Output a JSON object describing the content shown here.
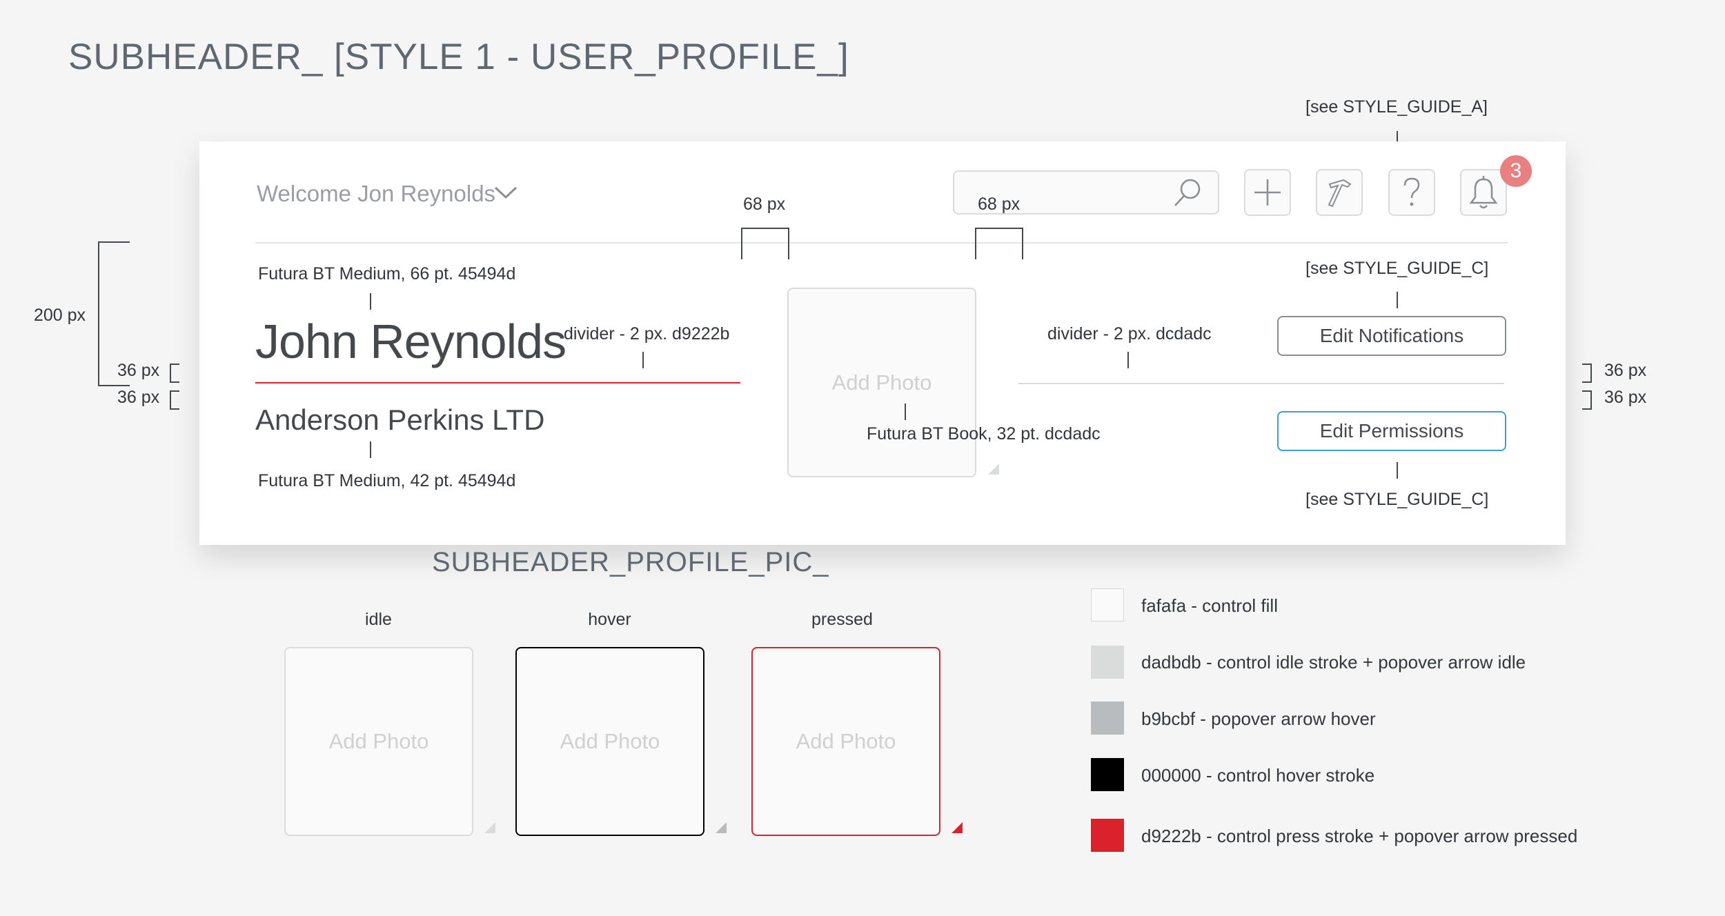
{
  "page": {
    "title": "SUBHEADER_ [STYLE 1 - USER_PROFILE_]"
  },
  "header": {
    "welcome": "Welcome Jon Reynolds",
    "notification_count": "3",
    "style_guide_a": "[see STYLE_GUIDE_A]"
  },
  "profile": {
    "name": "John Reynolds",
    "company": "Anderson Perkins LTD",
    "add_photo": "Add Photo",
    "edit_notifications": "Edit Notifications",
    "edit_permissions": "Edit Permissions"
  },
  "annotations": {
    "spacing_68_left": "68 px",
    "spacing_68_right": "68 px",
    "height_200": "200 px",
    "gap_36_a": "36 px",
    "gap_36_b": "36 px",
    "gap_36_c": "36 px",
    "gap_36_d": "36 px",
    "name_font": "Futura BT Medium, 66 pt. 45494d",
    "company_font": "Futura BT Medium, 42 pt. 45494d",
    "divider_red": "divider - 2 px. d9222b",
    "divider_grey": "divider - 2 px. dcdadc",
    "photo_font": "Futura BT Book, 32 pt. dcdadc",
    "style_guide_c_top": "[see STYLE_GUIDE_C]",
    "style_guide_c_bottom": "[see STYLE_GUIDE_C]"
  },
  "profile_pic": {
    "title": "SUBHEADER_PROFILE_PIC_",
    "states": [
      {
        "label": "idle",
        "text": "Add Photo"
      },
      {
        "label": "hover",
        "text": "Add Photo"
      },
      {
        "label": "pressed",
        "text": "Add Photo"
      }
    ]
  },
  "legend": [
    {
      "color": "#fafafa",
      "label": "fafafa - control fill"
    },
    {
      "color": "#dadbdb",
      "label": "dadbdb - control idle stroke + popover arrow idle"
    },
    {
      "color": "#b9bcbf",
      "label": "b9bcbf - popover arrow hover"
    },
    {
      "color": "#000000",
      "label": "000000 - control hover stroke"
    },
    {
      "color": "#d9222b",
      "label": "d9222b - control press stroke + popover arrow pressed"
    }
  ],
  "colors": {
    "accent_red": "#d9222b",
    "accent_blue": "#3d9fd1",
    "text_dark": "#45494d",
    "divider_grey": "#dcdadc",
    "badge": "#e88082"
  },
  "icons": [
    "chevron-down-icon",
    "search-icon",
    "plus-icon",
    "hammer-icon",
    "help-icon",
    "bell-icon",
    "popover-arrow-icon"
  ]
}
